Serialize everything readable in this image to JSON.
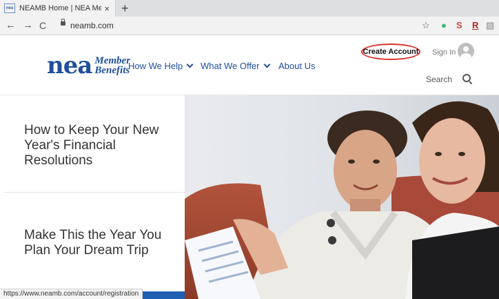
{
  "browser": {
    "tab_title": "NEAMB Home | NEA Member E",
    "tab_favicon_text": "nea",
    "tab_close": "×",
    "new_tab": "+",
    "back": "←",
    "forward": "→",
    "reload": "C",
    "url": "neamb.com",
    "status_url": "https://www.neamb.com/account/registration",
    "icons": [
      "star-icon",
      "green-extension-icon",
      "s-extension-icon",
      "r-extension-icon",
      "menu-extension-icon"
    ],
    "r_label": "R"
  },
  "header": {
    "logo_nea": "nea",
    "logo_member": "Member",
    "logo_benefits": "Benefits",
    "nav": [
      "How We Help",
      "What We Offer",
      "About Us"
    ],
    "create_account": "Create Account",
    "sign_in": "Sign In",
    "search": "Search",
    "accent_color": "#1e4f9c",
    "highlight_color": "#d8332a"
  },
  "stories": [
    "How to Keep Your New Year's Financial Resolutions",
    "Make This the Year You Plan Your Dream Trip"
  ]
}
